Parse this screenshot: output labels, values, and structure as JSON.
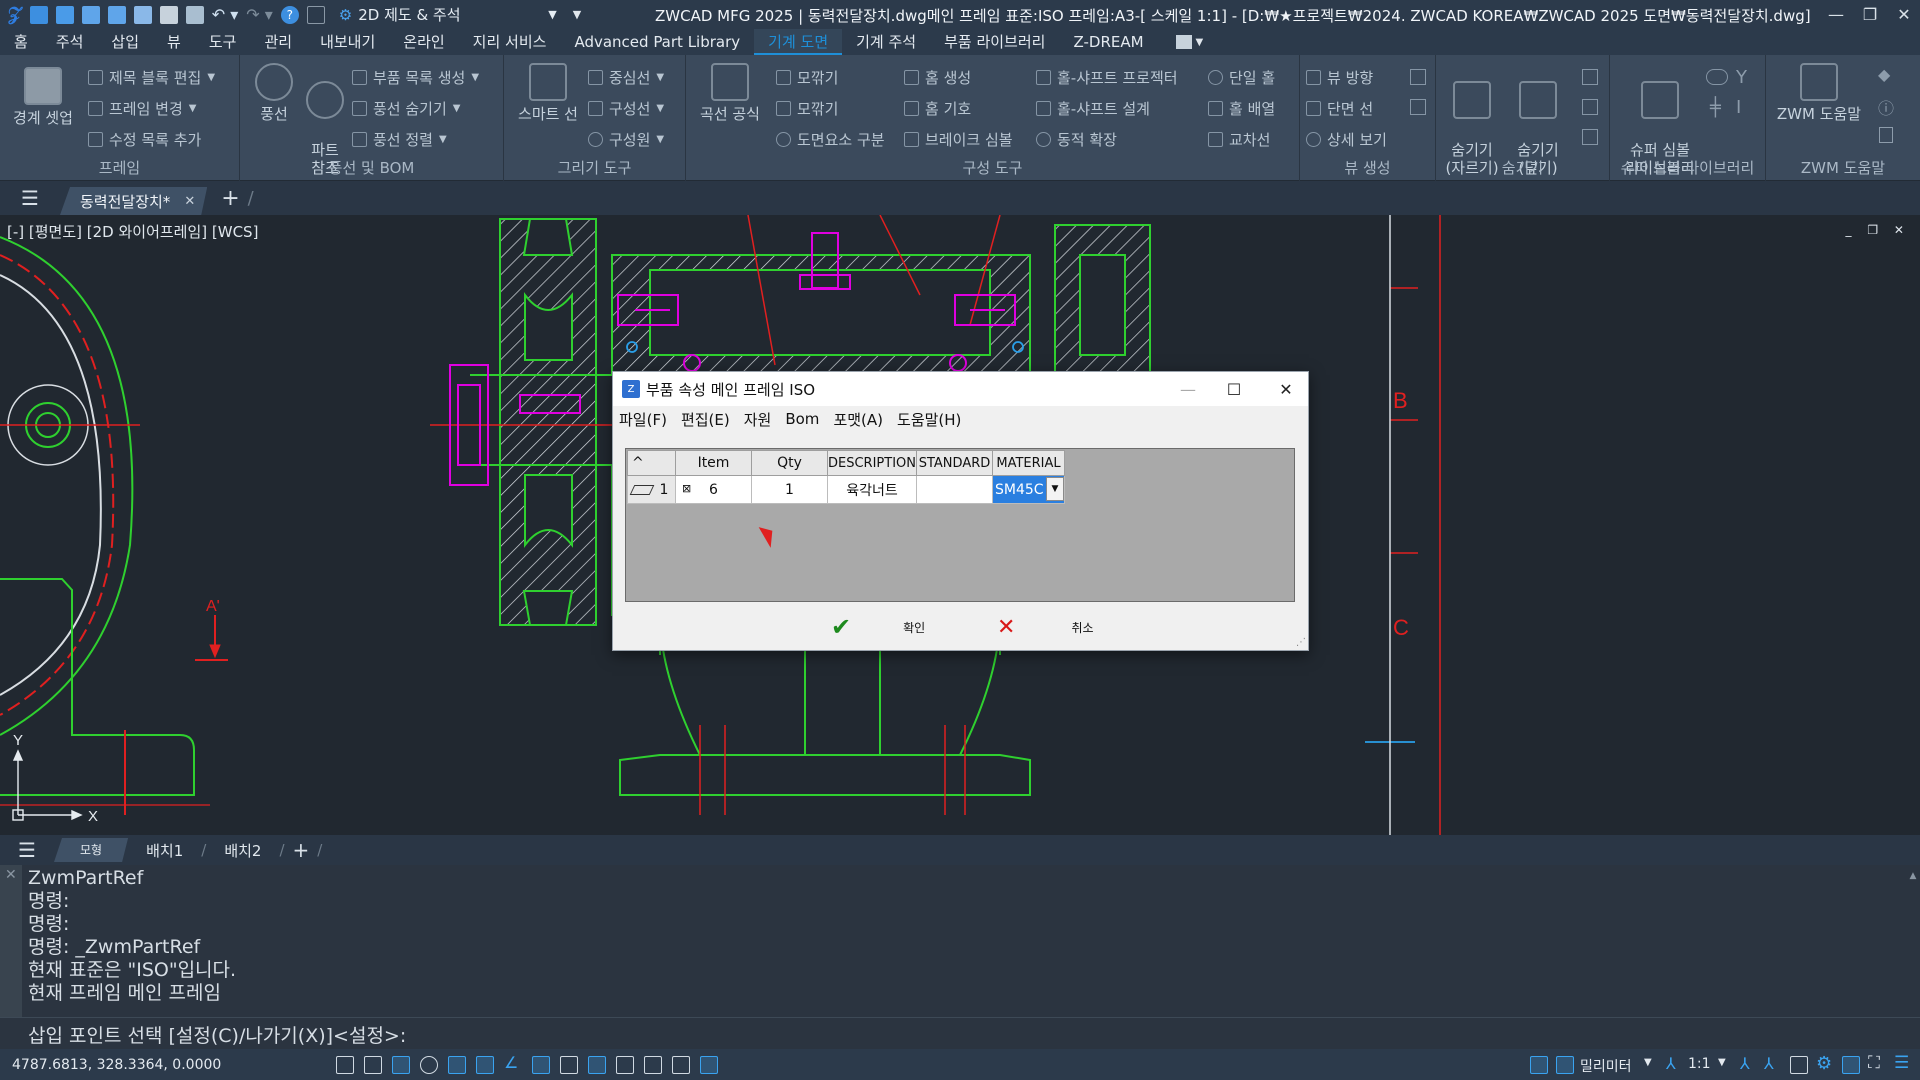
{
  "titlebar": {
    "workspace": "2D 제도 & 주석",
    "title": "ZWCAD MFG 2025 | 동력전달장치.dwg메인 프레임  표준:ISO 프레임:A3-[ 스케일 1:1] - [D:₩★프로젝트₩2024. ZWCAD KOREA₩ZWCAD 2025 도면₩동력전달장치.dwg]",
    "minimize": "—",
    "maximize": "❐",
    "close": "✕"
  },
  "menubar": {
    "items": [
      "홈",
      "주석",
      "삽입",
      "뷰",
      "도구",
      "관리",
      "내보내기",
      "온라인",
      "지리 서비스",
      "Advanced Part Library",
      "기계 도면",
      "기계 주석",
      "부품 라이브러리",
      "Z-DREAM"
    ],
    "active_index": 10
  },
  "ribbon": {
    "panels": {
      "frame": {
        "title": "프레임",
        "big": "경계 셋업",
        "items": [
          "제목 블록 편집",
          "프레임 변경",
          "수정 목록 추가"
        ]
      },
      "balloon": {
        "title": "풍선 및 BOM",
        "big1": "풍선",
        "big2": "파트\n참조",
        "items": [
          "부품 목록 생성",
          "풍선 숨기기",
          "풍선 정렬"
        ]
      },
      "draw": {
        "title": "그리기 도구",
        "big": "스마트 선",
        "items": [
          "중심선",
          "구성선",
          "구성원"
        ]
      },
      "construct": {
        "title": "구성 도구",
        "big": "곡선 공식",
        "col1": [
          "모깎기",
          "모깎기",
          "도면요소 구분"
        ],
        "col2": [
          "홈 생성",
          "홈 기호",
          "브레이크 심볼"
        ],
        "col3": [
          "홀-샤프트 프로젝터",
          "홀-샤프트 설계",
          "동적 확장"
        ],
        "col4": [
          "단일 홀",
          "홀 배열",
          "교차선"
        ]
      },
      "view": {
        "title": "뷰 생성",
        "items": [
          "뷰 방향",
          "단면 선",
          "상세 보기"
        ]
      },
      "hide": {
        "title": "숨기기",
        "big1": "숨기기\n(자르기)",
        "big2": "숨기기\n(덮기)"
      },
      "super": {
        "title": "슈퍼 심볼 라이브러리",
        "big": "슈퍼 심볼\n라이브러리"
      },
      "help": {
        "title": "ZWM 도움말",
        "big": "ZWM 도움말"
      }
    }
  },
  "doctabs": {
    "tab": "동력전달장치*",
    "close": "✕",
    "add": "+"
  },
  "canvas": {
    "view_label": "[-] [평면도] [2D 와이어프레임] [WCS]",
    "view_ctrl": "_ ❐ ✕",
    "labels": {
      "a_prime": "A'",
      "b": "B",
      "c": "C",
      "y": "Y",
      "x": "X"
    }
  },
  "layouttabs": {
    "tabs": [
      "모형",
      "배치1",
      "배치2"
    ],
    "add": "+"
  },
  "command": {
    "history": [
      "ZwmPartRef",
      "명령:",
      "명령:",
      "명령: _ZwmPartRef",
      "현재 표준은 \"ISO\"입니다.",
      "현재 프레임 메인 프레임"
    ],
    "prompt": "삽입 포인트 선택 [설정(C)/나가기(X)]<설정>:"
  },
  "statusbar": {
    "coords": "4787.6813, 328.3364, 0.0000",
    "units": "밀리미터",
    "scale": "1:1"
  },
  "dialog": {
    "title": "부품 속성 메인 프레임 ISO",
    "menu": [
      "파일(F)",
      "편집(E)",
      "자원",
      "Bom",
      "포맷(A)",
      "도움말(H)"
    ],
    "columns": [
      "^",
      "Item",
      "Qty",
      "DESCRIPTION",
      "STANDARD",
      "MATERIAL"
    ],
    "row": {
      "num": "1",
      "item": "6",
      "qty": "1",
      "description": "육각너트",
      "standard": "",
      "material": "SM45C"
    },
    "ok": "확인",
    "cancel": "취소"
  },
  "colors": {
    "accent": "#1e8fd8",
    "drawing_green": "#2fd02f",
    "drawing_red": "#e02020",
    "drawing_magenta": "#e000e0",
    "selection_blue": "#2a7fe0"
  }
}
